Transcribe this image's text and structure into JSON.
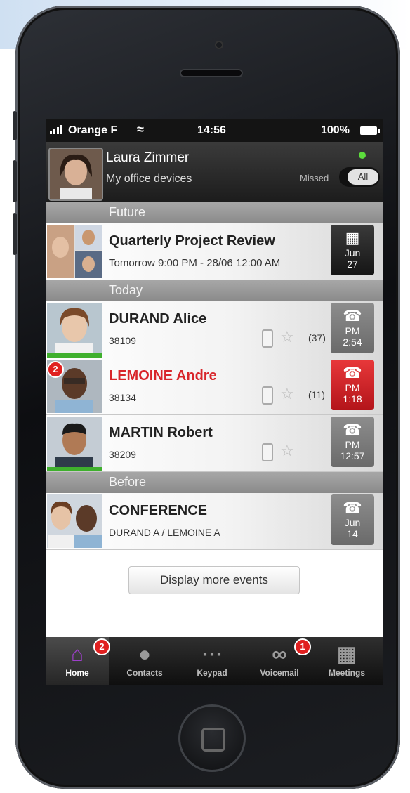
{
  "status_bar": {
    "carrier": "Orange F",
    "time": "14:56",
    "battery": "100%"
  },
  "header": {
    "name": "Laura Zimmer",
    "subtitle": "My office devices",
    "filter_missed": "Missed",
    "filter_all": "All",
    "presence_color": "#5cdc3c"
  },
  "sections": {
    "future": "Future",
    "today": "Today",
    "before": "Before"
  },
  "events": {
    "future": [
      {
        "title": "Quarterly Project Review",
        "detail": "Tomorrow 9:00 PM - 28/06 12:00 AM",
        "tile_l1": "Jun",
        "tile_l2": "27",
        "icon": "calendar-icon"
      }
    ],
    "today": [
      {
        "name": "DURAND Alice",
        "number": "38109",
        "count": "(37)",
        "tile_l1": "PM",
        "tile_l2": "2:54",
        "icon": "phone-icon",
        "missed": false
      },
      {
        "name": "LEMOINE Andre",
        "number": "38134",
        "count": "(11)",
        "tile_l1": "PM",
        "tile_l2": "1:18",
        "icon": "phone-icon",
        "missed": true,
        "badge": "2"
      },
      {
        "name": "MARTIN Robert",
        "number": "38209",
        "tile_l1": "PM",
        "tile_l2": "12:57",
        "icon": "phone-icon",
        "missed": false
      }
    ],
    "before": [
      {
        "name": "CONFERENCE",
        "detail": "DURAND A / LEMOINE A",
        "tile_l1": "Jun",
        "tile_l2": "14",
        "icon": "phone-icon"
      }
    ]
  },
  "more_button": "Display more events",
  "tabs": [
    {
      "label": "Home",
      "icon": "home-icon",
      "badge": "2",
      "active": true
    },
    {
      "label": "Contacts",
      "icon": "person-icon"
    },
    {
      "label": "Keypad",
      "icon": "keypad-icon"
    },
    {
      "label": "Voicemail",
      "icon": "voicemail-icon",
      "badge": "1"
    },
    {
      "label": "Meetings",
      "icon": "calendar-icon"
    }
  ],
  "colors": {
    "missed_red": "#d8262b",
    "accent_purple": "#9d3fc9"
  }
}
